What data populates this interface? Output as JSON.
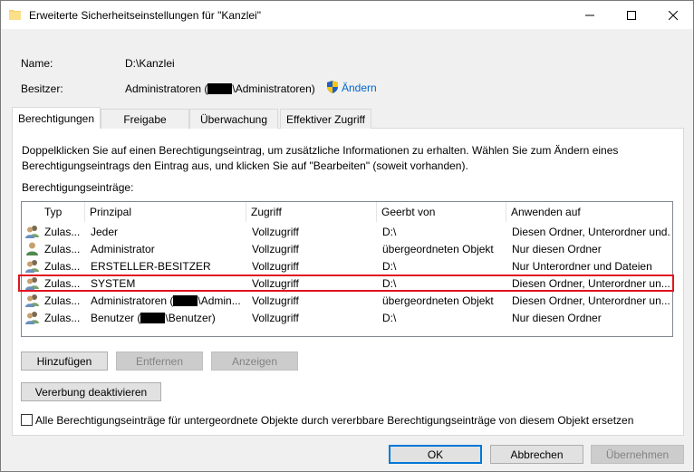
{
  "window": {
    "title": "Erweiterte Sicherheitseinstellungen für \"Kanzlei\"",
    "controls": [
      "minimize-icon",
      "maximize-icon",
      "close-icon"
    ]
  },
  "info": {
    "name_label": "Name:",
    "name_value": "D:\\Kanzlei",
    "owner_label": "Besitzer:",
    "owner_prefix": "Administratoren (",
    "owner_suffix": "\\Administratoren)",
    "change_link": "Ändern"
  },
  "tabs": [
    {
      "label": "Berechtigungen",
      "active": true
    },
    {
      "label": "Freigabe",
      "active": false
    },
    {
      "label": "Überwachung",
      "active": false
    },
    {
      "label": "Effektiver Zugriff",
      "active": false
    }
  ],
  "description": "Doppelklicken Sie auf einen Berechtigungseintrag, um zusätzliche Informationen zu erhalten. Wählen Sie zum Ändern eines Berechtigungseintrags den Eintrag aus, und klicken Sie auf \"Bearbeiten\" (soweit vorhanden).",
  "entries_label": "Berechtigungseinträge:",
  "columns": [
    "Typ",
    "Prinzipal",
    "Zugriff",
    "Geerbt von",
    "Anwenden auf"
  ],
  "rows": [
    {
      "icon": "group-icon",
      "type": "Zulas...",
      "principal": "Jeder",
      "access": "Vollzugriff",
      "inherited": "D:\\",
      "applies": "Diesen Ordner, Unterordner und..."
    },
    {
      "icon": "user-icon",
      "type": "Zulas...",
      "principal": "Administrator",
      "access": "Vollzugriff",
      "inherited": "übergeordneten Objekt",
      "applies": "Nur diesen Ordner"
    },
    {
      "icon": "group-icon",
      "type": "Zulas...",
      "principal": "ERSTELLER-BESITZER",
      "access": "Vollzugriff",
      "inherited": "D:\\",
      "applies": "Nur Unterordner und Dateien"
    },
    {
      "icon": "group-icon",
      "type": "Zulas...",
      "principal": "SYSTEM",
      "access": "Vollzugriff",
      "inherited": "D:\\",
      "applies": "Diesen Ordner, Unterordner un...",
      "highlighted": true
    },
    {
      "icon": "group-icon",
      "type": "Zulas...",
      "principal_prefix": "Administratoren (",
      "principal_suffix": "\\Admin...",
      "access": "Vollzugriff",
      "inherited": "übergeordneten Objekt",
      "applies": "Diesen Ordner, Unterordner un...",
      "redacted": true
    },
    {
      "icon": "group-icon",
      "type": "Zulas...",
      "principal_prefix": "Benutzer (",
      "principal_suffix": "\\Benutzer)",
      "access": "Vollzugriff",
      "inherited": "D:\\",
      "applies": "Nur diesen Ordner",
      "redacted": true
    }
  ],
  "buttons": {
    "add": "Hinzufügen",
    "remove": "Entfernen",
    "view": "Anzeigen",
    "disable_inheritance": "Vererbung deaktivieren",
    "ok": "OK",
    "cancel": "Abbrechen",
    "apply": "Übernehmen"
  },
  "replace_checkbox": {
    "label": "Alle Berechtigungseinträge für untergeordnete Objekte durch vererbbare Berechtigungseinträge von diesem Objekt ersetzen",
    "checked": false
  },
  "colors": {
    "accent": "#0078d7",
    "link": "#0066cc",
    "highlight_border": "#e0141e"
  }
}
